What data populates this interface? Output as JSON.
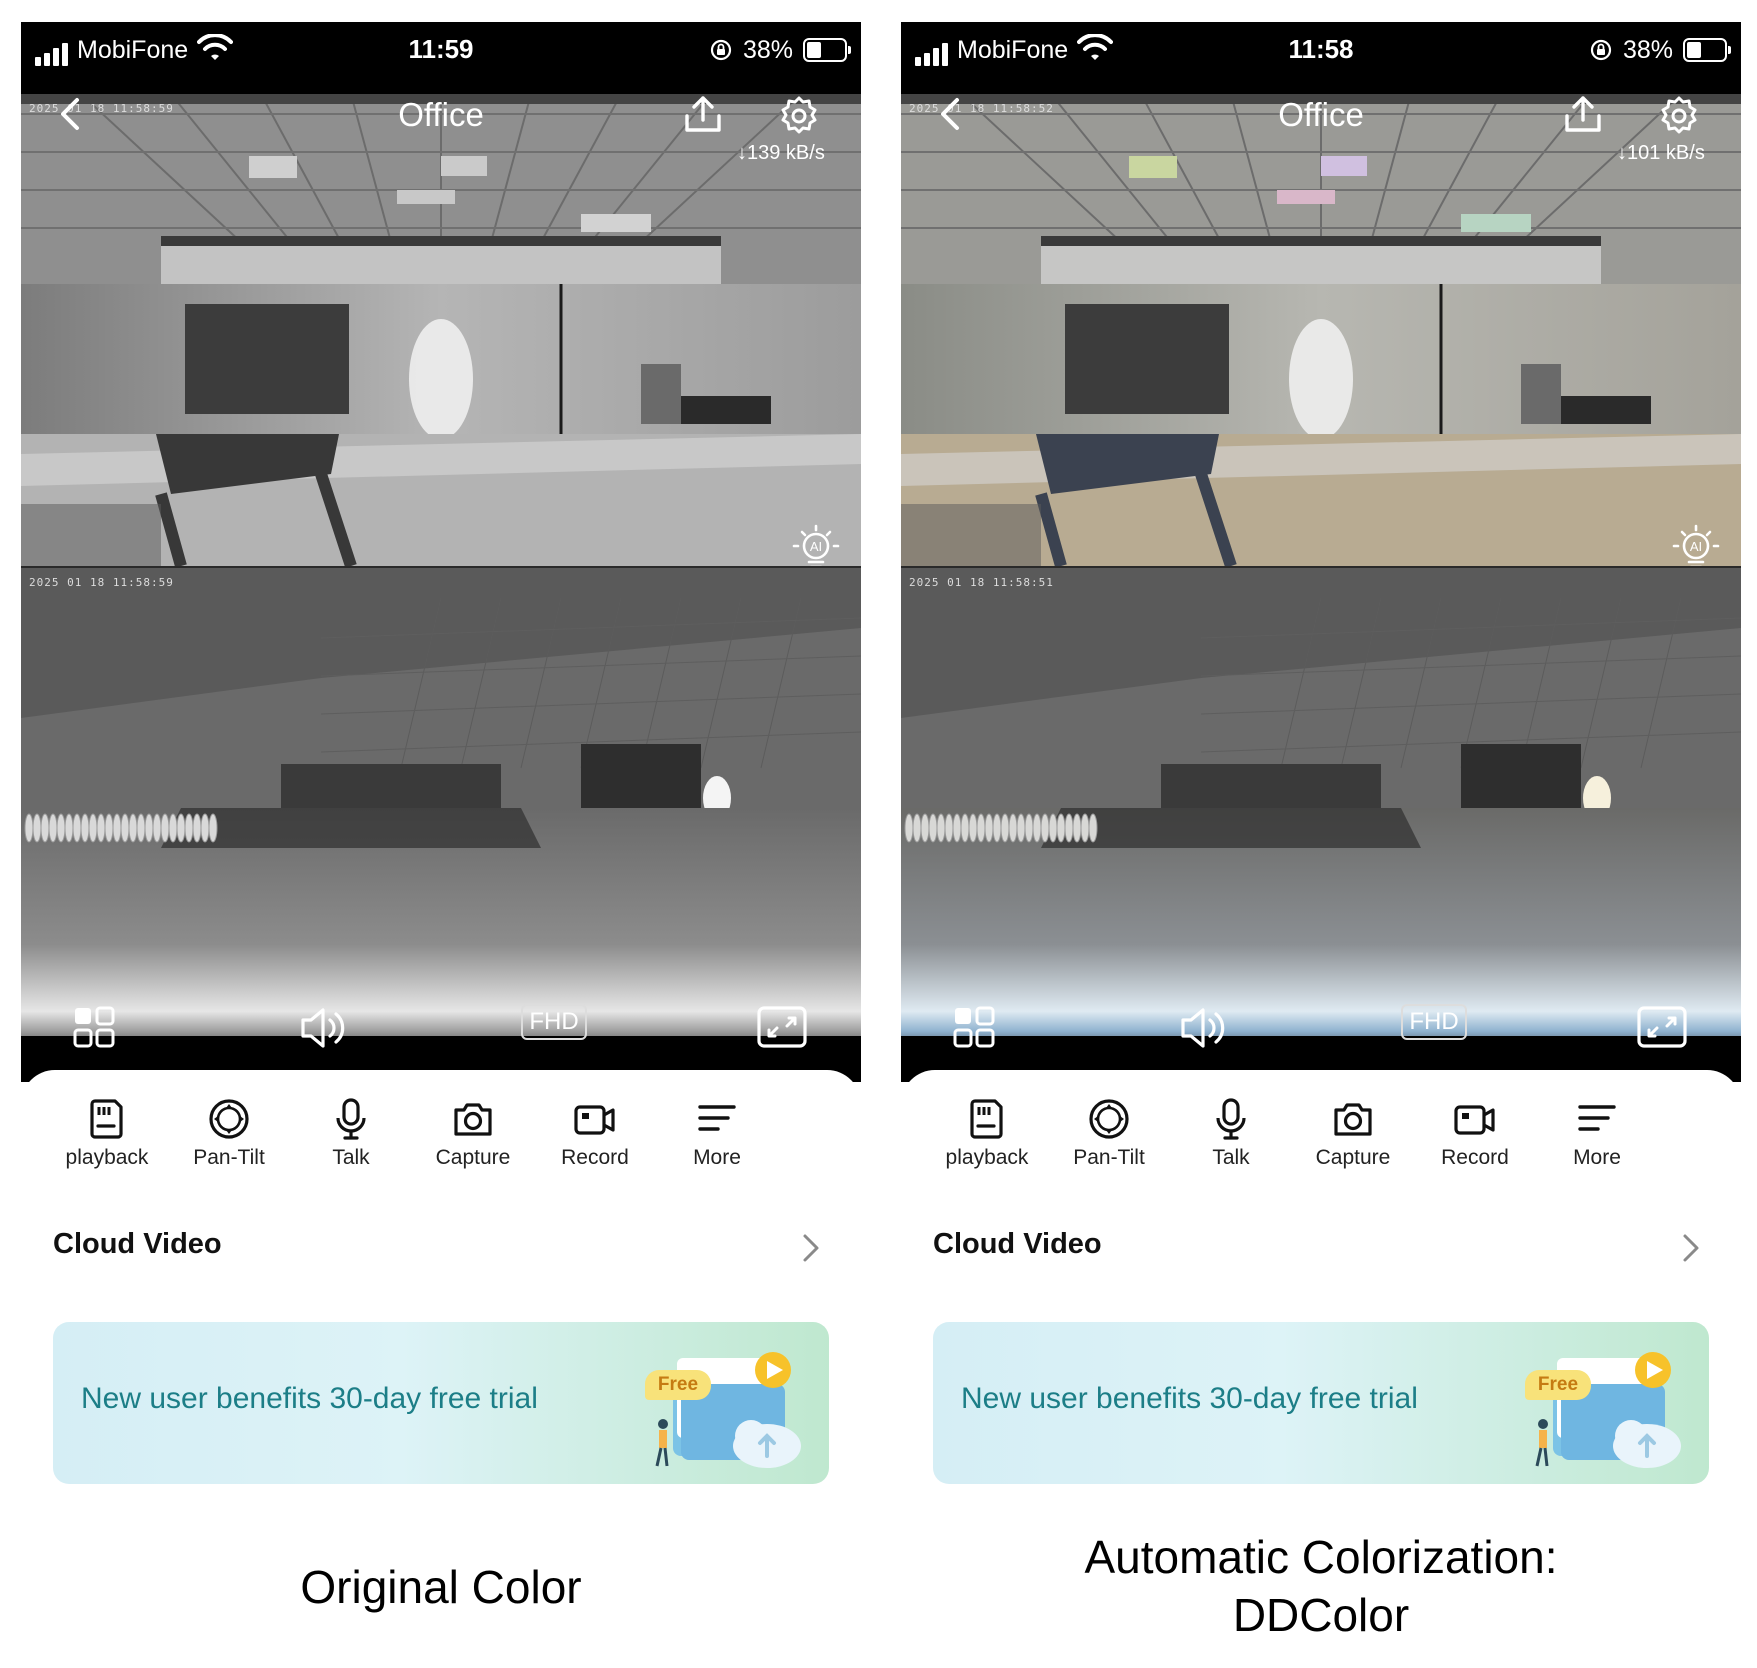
{
  "panels": [
    {
      "variant": "grayscale",
      "status": {
        "carrier": "MobiFone",
        "time": "11:59",
        "battery": "38%",
        "battery_level": 0.38
      },
      "header": {
        "title": "Office",
        "speed": "↓139 kB/s"
      },
      "feeds": [
        {
          "timestamp": "2025 01 18 11:58:59"
        },
        {
          "timestamp": "2025 01 18 11:58:59"
        }
      ],
      "video_toolbar": {
        "quality": "FHD"
      },
      "actions": [
        {
          "label": "playback",
          "icon": "sd-card-icon"
        },
        {
          "label": "Pan-Tilt",
          "icon": "pan-tilt-icon"
        },
        {
          "label": "Talk",
          "icon": "microphone-icon"
        },
        {
          "label": "Capture",
          "icon": "camera-icon"
        },
        {
          "label": "Record",
          "icon": "video-camera-icon"
        },
        {
          "label": "More",
          "icon": "menu-lines-icon"
        }
      ],
      "cloud": {
        "title": "Cloud Video"
      },
      "banner": {
        "text": "New user benefits 30-day free trial",
        "tag": "Free"
      },
      "caption": "Original Color"
    },
    {
      "variant": "colorized",
      "status": {
        "carrier": "MobiFone",
        "time": "11:58",
        "battery": "38%",
        "battery_level": 0.38
      },
      "header": {
        "title": "Office",
        "speed": "↓101 kB/s"
      },
      "feeds": [
        {
          "timestamp": "2025 01 18 11:58:52"
        },
        {
          "timestamp": "2025 01 18 11:58:51"
        }
      ],
      "video_toolbar": {
        "quality": "FHD"
      },
      "actions": [
        {
          "label": "playback",
          "icon": "sd-card-icon"
        },
        {
          "label": "Pan-Tilt",
          "icon": "pan-tilt-icon"
        },
        {
          "label": "Talk",
          "icon": "microphone-icon"
        },
        {
          "label": "Capture",
          "icon": "camera-icon"
        },
        {
          "label": "Record",
          "icon": "video-camera-icon"
        },
        {
          "label": "More",
          "icon": "menu-lines-icon"
        }
      ],
      "cloud": {
        "title": "Cloud Video"
      },
      "banner": {
        "text": "New user benefits 30-day free trial",
        "tag": "Free"
      },
      "caption_line1": "Automatic Colorization:",
      "caption_line2": "DDColor"
    }
  ],
  "colors": {
    "status_bar": "#000000",
    "banner_text": "#1c7e87",
    "banner_start": "#d5eef5",
    "banner_end": "#bfe8cf",
    "free_tag": "#f8e27a"
  }
}
